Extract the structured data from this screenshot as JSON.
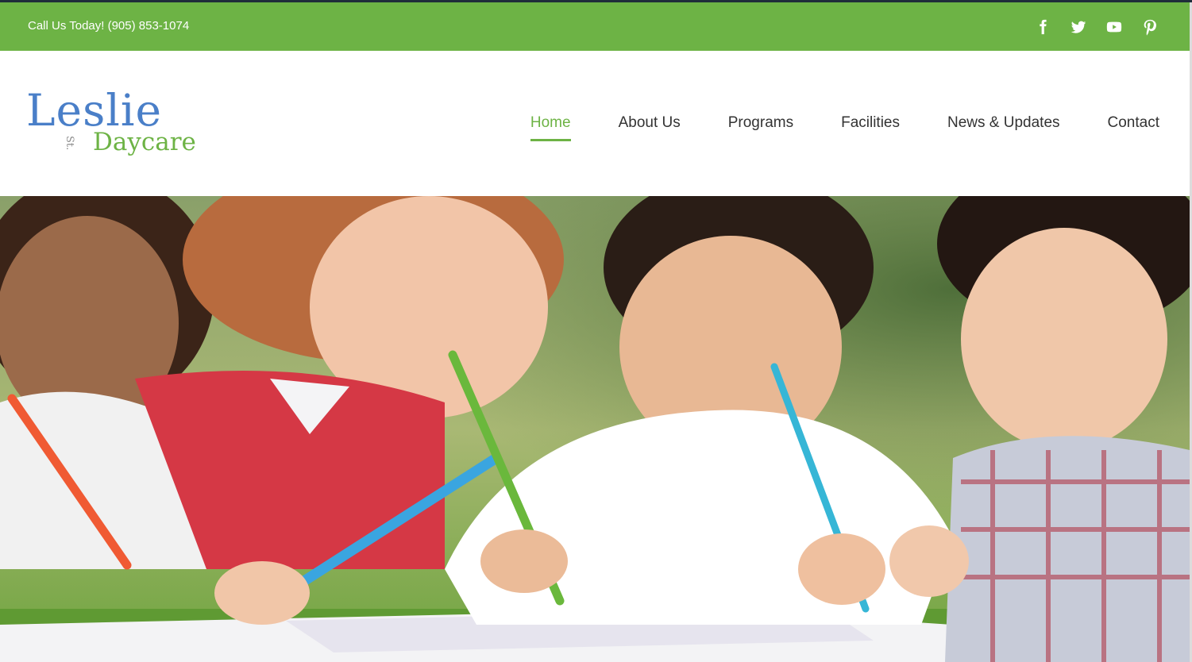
{
  "topbar": {
    "phone_text": "Call Us Today! (905) 853-1074",
    "background": "#6db345",
    "social": [
      "facebook-icon",
      "twitter-icon",
      "youtube-icon",
      "pinterest-icon"
    ]
  },
  "logo": {
    "main": "Leslie",
    "st": "St.",
    "sub": "Daycare",
    "colors": {
      "main": "#4a7fc8",
      "sub": "#6db345"
    }
  },
  "nav": {
    "items": [
      {
        "label": "Home",
        "active": true
      },
      {
        "label": "About Us",
        "active": false
      },
      {
        "label": "Programs",
        "active": false
      },
      {
        "label": "Facilities",
        "active": false
      },
      {
        "label": "News & Updates",
        "active": false
      },
      {
        "label": "Contact",
        "active": false
      }
    ],
    "accent": "#6db345"
  },
  "hero": {
    "subject": "children-drawing-photo"
  }
}
